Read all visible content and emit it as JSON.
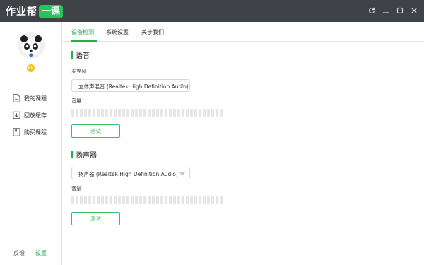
{
  "app": {
    "logo_text": "作业帮",
    "logo_badge": "一课"
  },
  "window_controls": [
    "refresh-icon",
    "minimize-icon",
    "maximize-icon",
    "close-icon"
  ],
  "sidebar": {
    "level_badge": "Lv",
    "items": [
      {
        "label": "我的课程",
        "icon": "document-icon"
      },
      {
        "label": "回放缓存",
        "icon": "download-icon"
      },
      {
        "label": "购买课程",
        "icon": "bookmark-icon"
      }
    ],
    "feedback": "反馈",
    "settings": "设置"
  },
  "tabs": [
    {
      "label": "设备检测",
      "active": true
    },
    {
      "label": "系统设置",
      "active": false
    },
    {
      "label": "关于我们",
      "active": false
    }
  ],
  "voice_section": {
    "title": "语音",
    "mic_label": "麦克风",
    "mic_value": "立体声混音 (Realtek High Definition Audio)",
    "volume_label": "音量",
    "volume_level": 0,
    "test_button": "测试"
  },
  "speaker_section": {
    "title": "扬声器",
    "speaker_value": "扬声器 (Realtek High Definition Audio)",
    "volume_label": "音量",
    "volume_level": 0,
    "test_button": "测试"
  },
  "colors": {
    "accent": "#22b24c",
    "titlebar": "#3f4246"
  }
}
